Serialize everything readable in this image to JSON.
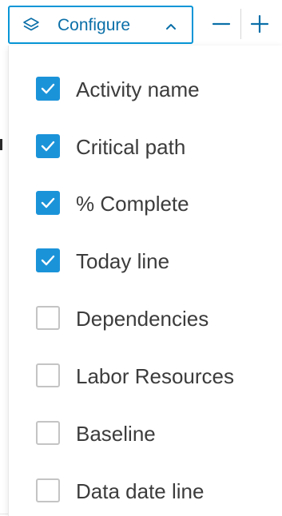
{
  "toolbar": {
    "configure_label": "Configure",
    "configure_icon": "layers-icon",
    "toggle_icon": "chevron-up-icon",
    "zoom_out_icon": "minus-icon",
    "zoom_in_icon": "plus-icon",
    "accent_color": "#0696d7"
  },
  "options": [
    {
      "label": "Activity name",
      "checked": true
    },
    {
      "label": "Critical path",
      "checked": true
    },
    {
      "label": "% Complete",
      "checked": true
    },
    {
      "label": "Today line",
      "checked": true
    },
    {
      "label": "Dependencies",
      "checked": false
    },
    {
      "label": "Labor Resources",
      "checked": false
    },
    {
      "label": "Baseline",
      "checked": false
    },
    {
      "label": "Data date line",
      "checked": false
    }
  ],
  "colors": {
    "checkbox_checked": "#1b93d9",
    "checkbox_unchecked_border": "#c4c4c4",
    "text": "#3c3c3c"
  }
}
